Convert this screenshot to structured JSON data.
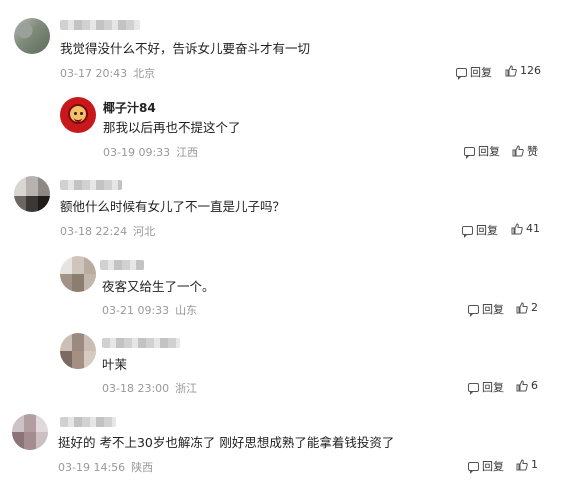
{
  "actions": {
    "reply_label": "回复",
    "like_label_plain": "赞"
  },
  "comments": [
    {
      "username": "",
      "text": "我觉得没什么不好，告诉女儿要奋斗才有一切",
      "date": "03-17 20:43",
      "location": "北京",
      "likes": "126"
    },
    {
      "username": "椰子汁84",
      "text": "那我以后再也不提这个了",
      "date": "03-19 09:33",
      "location": "江西",
      "likes": "赞"
    },
    {
      "username": "",
      "text": "额他什么时候有女儿了不一直是儿子吗？",
      "date": "03-18 22:24",
      "location": "河北",
      "likes": "41"
    },
    {
      "username": "",
      "text": "夜客又给生了一个。",
      "date": "03-21 09:33",
      "location": "山东",
      "likes": "2"
    },
    {
      "username": "",
      "text": "叶茉",
      "date": "03-18 23:00",
      "location": "浙江",
      "likes": "6"
    },
    {
      "username": "",
      "text": "挺好的 考不上30岁也解冻了 刚好思想成熟了能拿着钱投资了",
      "date": "03-19 14:56",
      "location": "陕西",
      "likes": "1"
    }
  ]
}
